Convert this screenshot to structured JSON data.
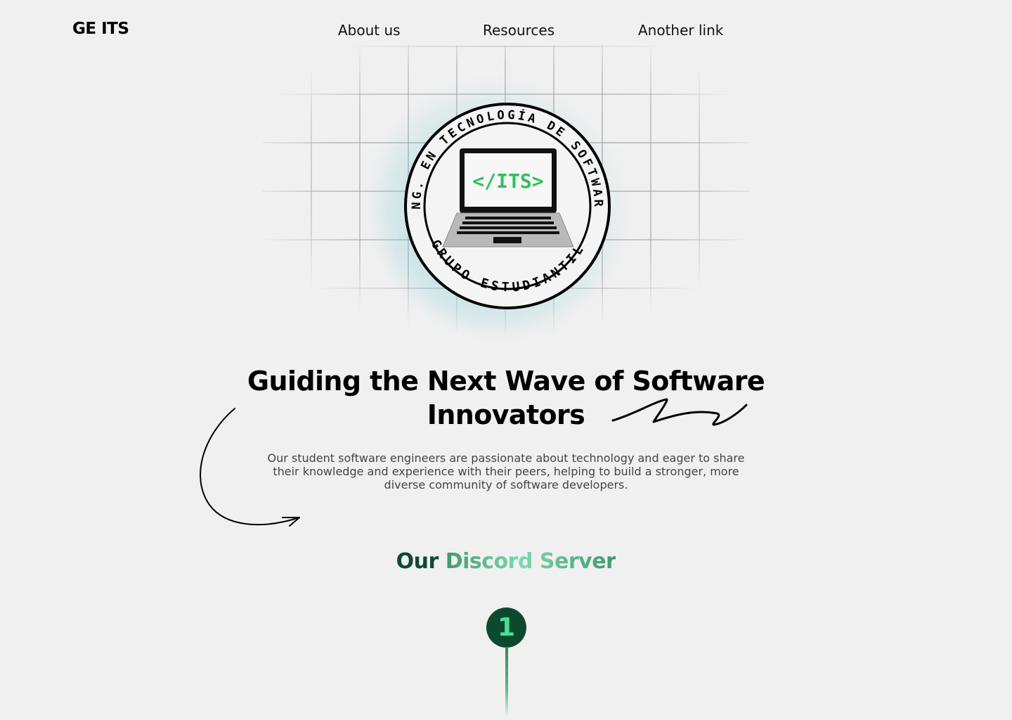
{
  "header": {
    "brand": "GE ITS",
    "nav": [
      "About us",
      "Resources",
      "Another link"
    ]
  },
  "hero": {
    "logo": {
      "arc_text_top": "ING. EN TECNOLOGÍA DE SOFTWARE",
      "arc_text_bottom": "GRUPO ESTUDIANTIL",
      "screen_text": "</ITS>"
    },
    "headline_line1": "Guiding the Next Wave of Software",
    "headline_line2": "Innovators",
    "description": "Our student software engineers are passionate about technology and eager to share their knowledge and experience with their peers, helping to build a stronger, more diverse community of software developers."
  },
  "discord": {
    "title_part1": "Our",
    "title_part2": "Discord Server",
    "step_number": "1"
  },
  "colors": {
    "background": "#f0f0f0",
    "accent_dark": "#0c4a30",
    "accent_green": "#4de08e",
    "text_muted": "#444444"
  }
}
